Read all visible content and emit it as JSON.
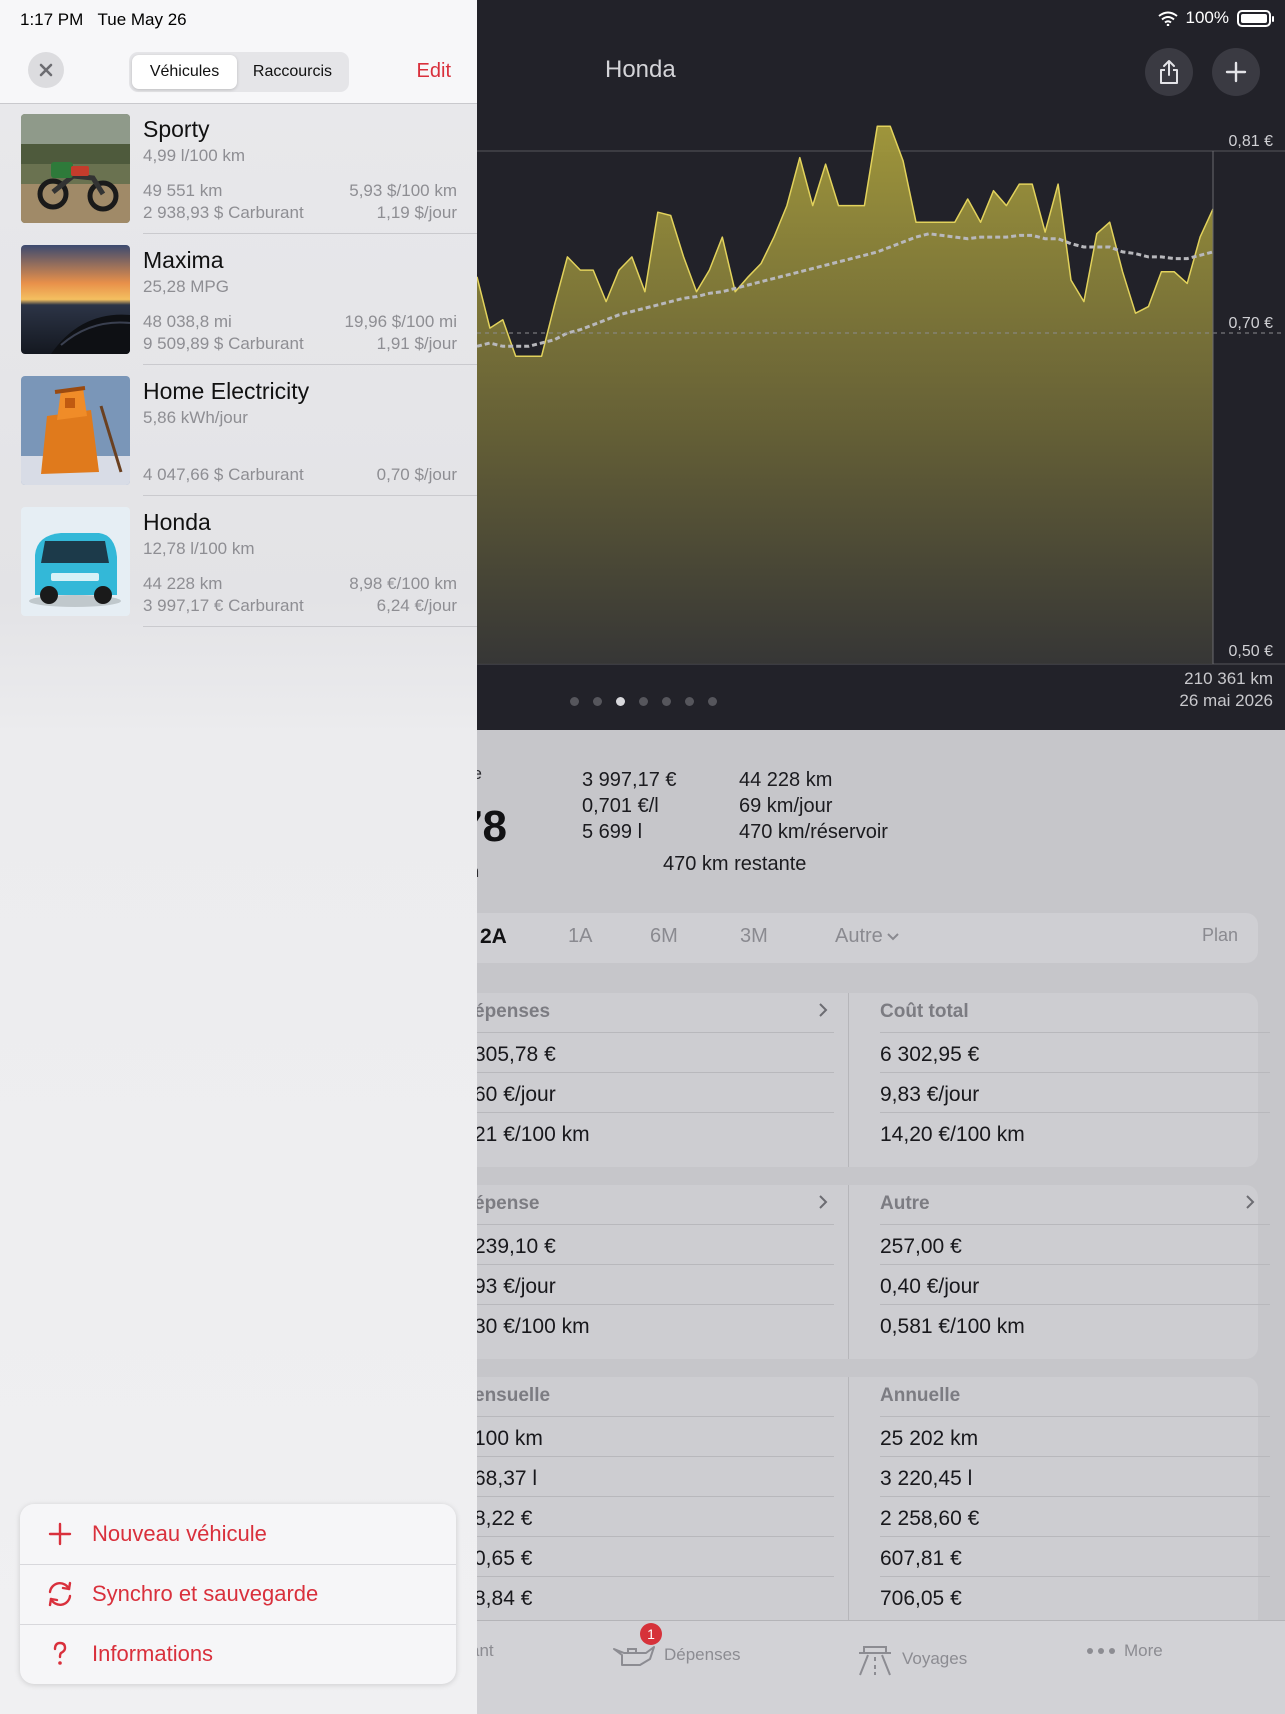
{
  "status": {
    "time": "1:17 PM",
    "date": "Tue May 26",
    "battery": "100%"
  },
  "header": {
    "title": "Honda"
  },
  "chart_data": {
    "type": "area",
    "y_ticks": [
      "0,81 €",
      "0,70 €",
      "0,50 €"
    ],
    "ylim": [
      0.5,
      0.81
    ],
    "series": [
      {
        "values": [
          0.734,
          0.703,
          0.708,
          0.686,
          0.686,
          0.686,
          0.717,
          0.746,
          0.738,
          0.738,
          0.719,
          0.738,
          0.746,
          0.725,
          0.773,
          0.771,
          0.746,
          0.725,
          0.738,
          0.758,
          0.725,
          0.734,
          0.742,
          0.758,
          0.777,
          0.806,
          0.777,
          0.802,
          0.777,
          0.777,
          0.777,
          0.825,
          0.825,
          0.804,
          0.767,
          0.767,
          0.767,
          0.767,
          0.781,
          0.767,
          0.786,
          0.777,
          0.79,
          0.79,
          0.761,
          0.79,
          0.732,
          0.719,
          0.76,
          0.767,
          0.737,
          0.712,
          0.716,
          0.737,
          0.737,
          0.73,
          0.758,
          0.775
        ]
      },
      {
        "values": [
          0.692,
          0.694,
          0.692,
          0.692,
          0.692,
          0.694,
          0.696,
          0.7,
          0.702,
          0.705,
          0.708,
          0.711,
          0.713,
          0.715,
          0.717,
          0.719,
          0.721,
          0.722,
          0.724,
          0.725,
          0.727,
          0.729,
          0.731,
          0.733,
          0.735,
          0.737,
          0.739,
          0.741,
          0.743,
          0.745,
          0.747,
          0.749,
          0.752,
          0.755,
          0.758,
          0.76,
          0.759,
          0.758,
          0.757,
          0.758,
          0.758,
          0.758,
          0.759,
          0.759,
          0.757,
          0.757,
          0.754,
          0.752,
          0.752,
          0.752,
          0.749,
          0.748,
          0.746,
          0.746,
          0.745,
          0.745,
          0.747,
          0.749
        ]
      }
    ],
    "x_end_labels": [
      "210 361 km",
      "26 mai 2026"
    ]
  },
  "pager": {
    "count": 7,
    "active": 2
  },
  "summary": {
    "big_fragment": "78",
    "col1": [
      "3 997,17 €",
      "0,701 €/l",
      "5 699 l"
    ],
    "col2": [
      "44 228 km",
      "69 km/jour",
      "470 km/réservoir"
    ],
    "remaining": "470 km restante"
  },
  "periods": {
    "items": [
      "2A",
      "1A",
      "6M",
      "3M",
      "Autre"
    ],
    "plan": "Plan"
  },
  "cards": [
    {
      "left": {
        "head": "épenses",
        "rows": [
          "305,78 €",
          "60 €/jour",
          "21 €/100 km"
        ],
        "chevron": true
      },
      "right": {
        "head": "Coût total",
        "rows": [
          "6 302,95 €",
          "9,83 €/jour",
          "14,20 €/100 km"
        ],
        "chevron": false
      }
    },
    {
      "left": {
        "head": "épense",
        "rows": [
          "239,10 €",
          "93 €/jour",
          "30 €/100 km"
        ],
        "chevron": true
      },
      "right": {
        "head": "Autre",
        "rows": [
          "257,00 €",
          "0,40 €/jour",
          "0,581 €/100 km"
        ],
        "chevron": true
      }
    },
    {
      "left": {
        "head": "ensuelle",
        "rows": [
          "100 km",
          "68,37 l",
          "8,22 €",
          "0,65 €",
          "8,84 €"
        ],
        "chevron": false
      },
      "right": {
        "head": "Annuelle",
        "rows": [
          "25 202 km",
          "3 220,45 l",
          "2 258,60 €",
          "607,81 €",
          "706,05 €"
        ],
        "chevron": false
      }
    }
  ],
  "tabs": {
    "items": [
      "ant",
      "Dépenses",
      "Voyages",
      "More"
    ],
    "badge": "1"
  },
  "sidebar": {
    "segments": [
      "Véhicules",
      "Raccourcis"
    ],
    "edit": "Edit",
    "vehicles": [
      {
        "name": "Sporty",
        "sub": "4,99 l/100 km",
        "l1": "49 551 km",
        "r1": "5,93 $/100 km",
        "l2": "2 938,93 $ Carburant",
        "r2": "1,19 $/jour"
      },
      {
        "name": "Maxima",
        "sub": "25,28 MPG",
        "l1": "48 038,8 mi",
        "r1": "19,96 $/100 mi",
        "l2": "9 509,89 $ Carburant",
        "r2": "1,91 $/jour"
      },
      {
        "name": "Home Electricity",
        "sub": "5,86 kWh/jour",
        "l1": "",
        "r1": "",
        "l2": "4 047,66 $ Carburant",
        "r2": "0,70 $/jour"
      },
      {
        "name": "Honda",
        "sub": "12,78 l/100 km",
        "l1": "44 228 km",
        "r1": "8,98 €/100 km",
        "l2": "3 997,17 € Carburant",
        "r2": "6,24 €/jour"
      }
    ],
    "actions": [
      "Nouveau véhicule",
      "Synchro et sauvegarde",
      "Informations"
    ]
  },
  "colors": {
    "accent": "#d9303c",
    "chart_fill": "#a59b3c",
    "chart_line": "#e2d25c"
  }
}
